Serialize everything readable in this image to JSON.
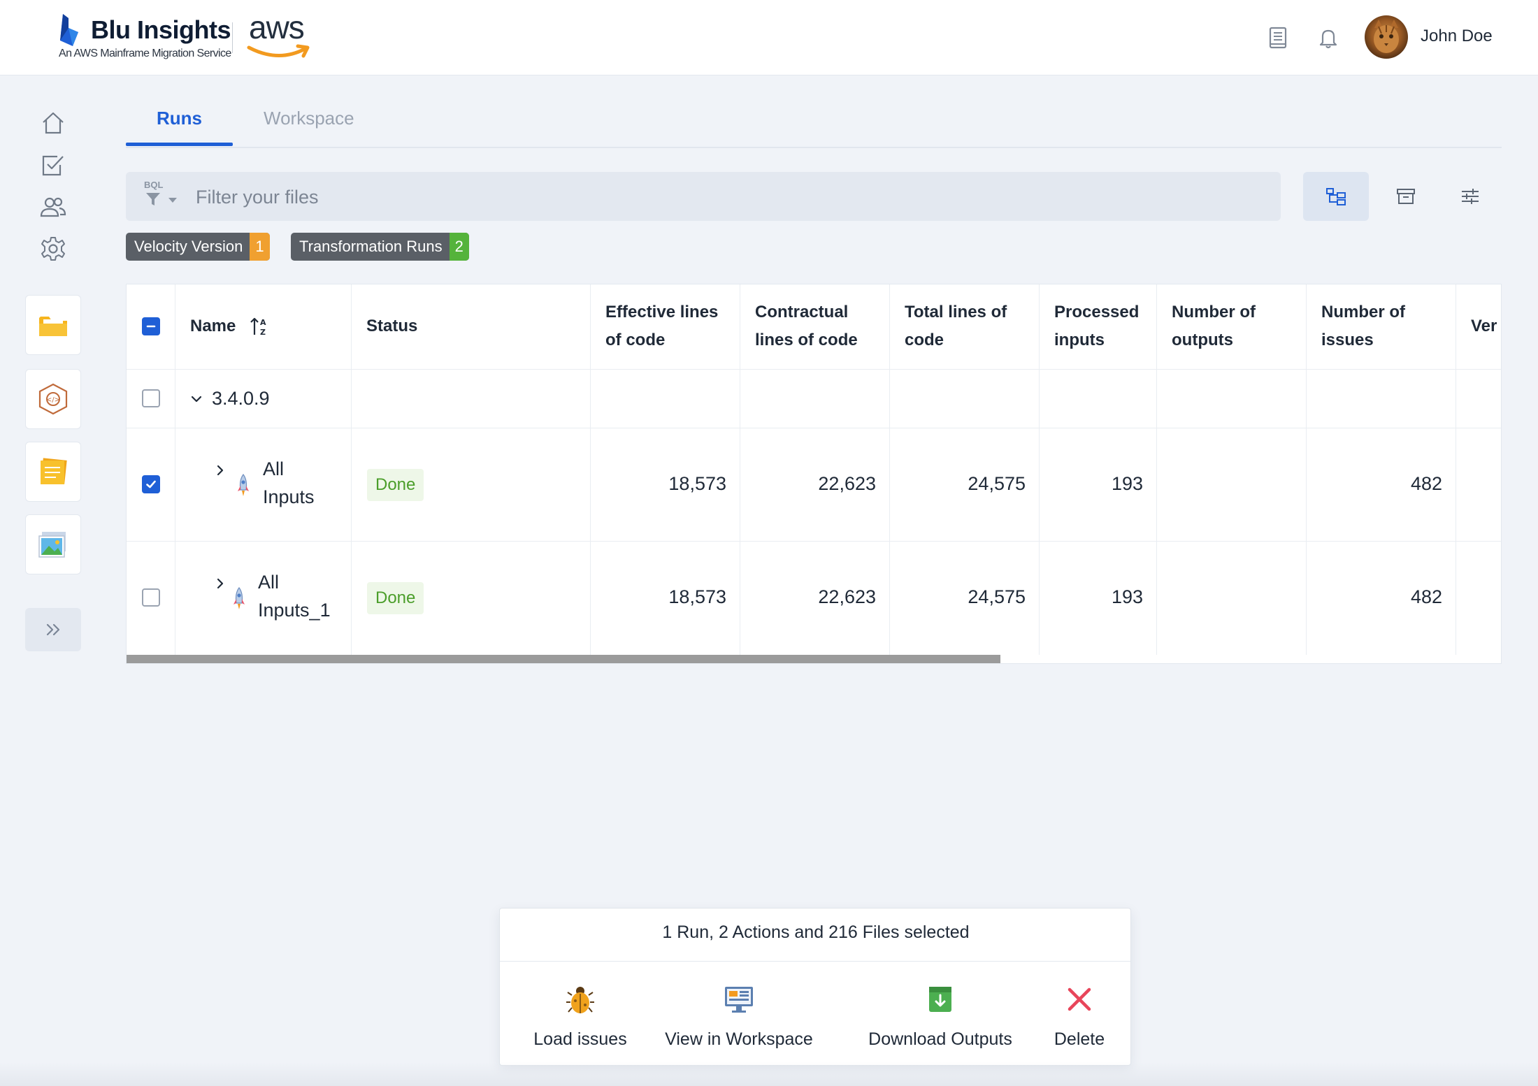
{
  "header": {
    "brand_title": "Blu Insights",
    "brand_subtitle": "An AWS Mainframe Migration Service",
    "aws_text": "aws",
    "user_name": "John Doe"
  },
  "tabs": [
    {
      "label": "Runs",
      "active": true
    },
    {
      "label": "Workspace",
      "active": false
    }
  ],
  "filter": {
    "prefix": "BQL",
    "placeholder": "Filter your files",
    "value": ""
  },
  "chips": [
    {
      "label": "Velocity Version",
      "count": "1",
      "count_color": "#f0a030"
    },
    {
      "label": "Transformation Runs",
      "count": "2",
      "count_color": "#55b33b"
    }
  ],
  "table": {
    "columns": {
      "name": "Name",
      "status": "Status",
      "effective_loc": "Effective lines of code",
      "contractual_loc": "Contractual lines of code",
      "total_loc": "Total lines of code",
      "processed_inputs": "Processed inputs",
      "outputs": "Number of outputs",
      "issues": "Number of issues",
      "version": "Ver"
    },
    "group": {
      "label": "3.4.0.9",
      "checked": false
    },
    "rows": [
      {
        "name_line1": "All",
        "name_line2": "Inputs",
        "status": "Done",
        "effective": "18,573",
        "contractual": "22,623",
        "total": "24,575",
        "processed": "193",
        "outputs": "",
        "issues": "482",
        "checked": true
      },
      {
        "name_line1": "All",
        "name_line2": "Inputs_1",
        "status": "Done",
        "effective": "18,573",
        "contractual": "22,623",
        "total": "24,575",
        "processed": "193",
        "outputs": "",
        "issues": "482",
        "checked": false
      }
    ]
  },
  "selection": {
    "summary": "1 Run, 2 Actions and 216 Files selected",
    "actions": [
      {
        "label": "Load issues",
        "icon": "bug-icon"
      },
      {
        "label": "View in Workspace",
        "icon": "workspace-icon"
      },
      {
        "label": "Download Outputs",
        "icon": "download-icon"
      },
      {
        "label": "Delete",
        "icon": "delete-icon"
      }
    ]
  },
  "colors": {
    "accent": "#1f5fd6",
    "done_text": "#4b9e2a",
    "done_bg": "#eef7e8",
    "chip_bg": "#5a5f66",
    "delete": "#e8455a"
  }
}
